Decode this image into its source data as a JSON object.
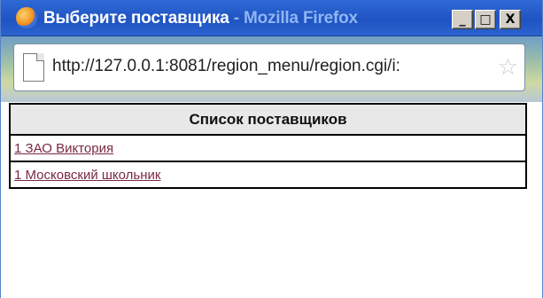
{
  "window": {
    "title": "Выберите поставщика",
    "title_sep": " - ",
    "app_name": "Mozilla Firefox",
    "min_label": "_",
    "max_label": "□",
    "close_label": "X"
  },
  "address_bar": {
    "url": "http://127.0.0.1:8081/region_menu/region.cgi/i:"
  },
  "table": {
    "header": "Список поставщиков",
    "rows": [
      {
        "link": "1 ЗАО Виктория"
      },
      {
        "link": "1 Московский школьник"
      }
    ]
  },
  "colors": {
    "titlebar": "#2257c8",
    "link": "#7a2a40",
    "header_bg": "#e8e8e8"
  }
}
